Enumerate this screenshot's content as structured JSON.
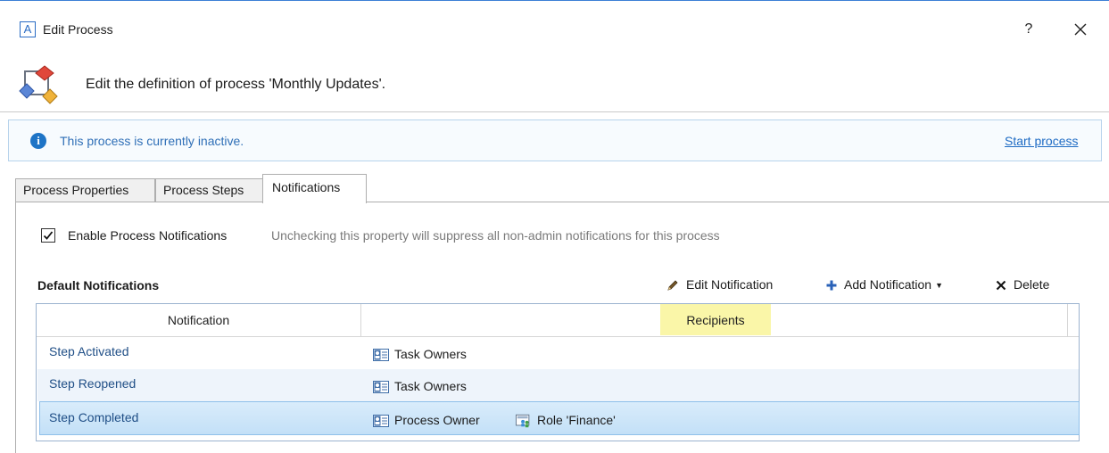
{
  "window": {
    "app_icon_letter": "A",
    "title": "Edit Process",
    "help": "?"
  },
  "header": {
    "description": "Edit the definition of process 'Monthly Updates'."
  },
  "banner": {
    "message": "This process is currently inactive.",
    "action": "Start process"
  },
  "tabs": [
    {
      "label": "Process Properties"
    },
    {
      "label": "Process Steps"
    },
    {
      "label": "Notifications",
      "active": true
    }
  ],
  "notifications_tab": {
    "enable_checked": true,
    "enable_label": "Enable Process Notifications",
    "enable_hint": "Unchecking this property will suppress all non-admin notifications for this process",
    "section_title": "Default Notifications",
    "toolbar": {
      "edit": "Edit Notification",
      "add": "Add Notification",
      "delete": "Delete"
    },
    "columns": {
      "notification": "Notification",
      "recipients": "Recipients"
    },
    "rows": [
      {
        "name": "Step Activated",
        "recipients": [
          {
            "label": "Task Owners",
            "icon": "contact-card-icon"
          }
        ]
      },
      {
        "name": "Step Reopened",
        "recipients": [
          {
            "label": "Task Owners",
            "icon": "contact-card-icon"
          }
        ]
      },
      {
        "name": "Step Completed",
        "selected": true,
        "recipients": [
          {
            "label": "Process Owner",
            "icon": "contact-card-icon"
          },
          {
            "label": "Role 'Finance'",
            "icon": "role-group-icon"
          }
        ]
      }
    ]
  },
  "colors": {
    "accent": "#1e6bc4",
    "banner_text": "#2f6fb7",
    "selected_row": "#c3e0f7",
    "header_highlight": "#faf6a8"
  }
}
